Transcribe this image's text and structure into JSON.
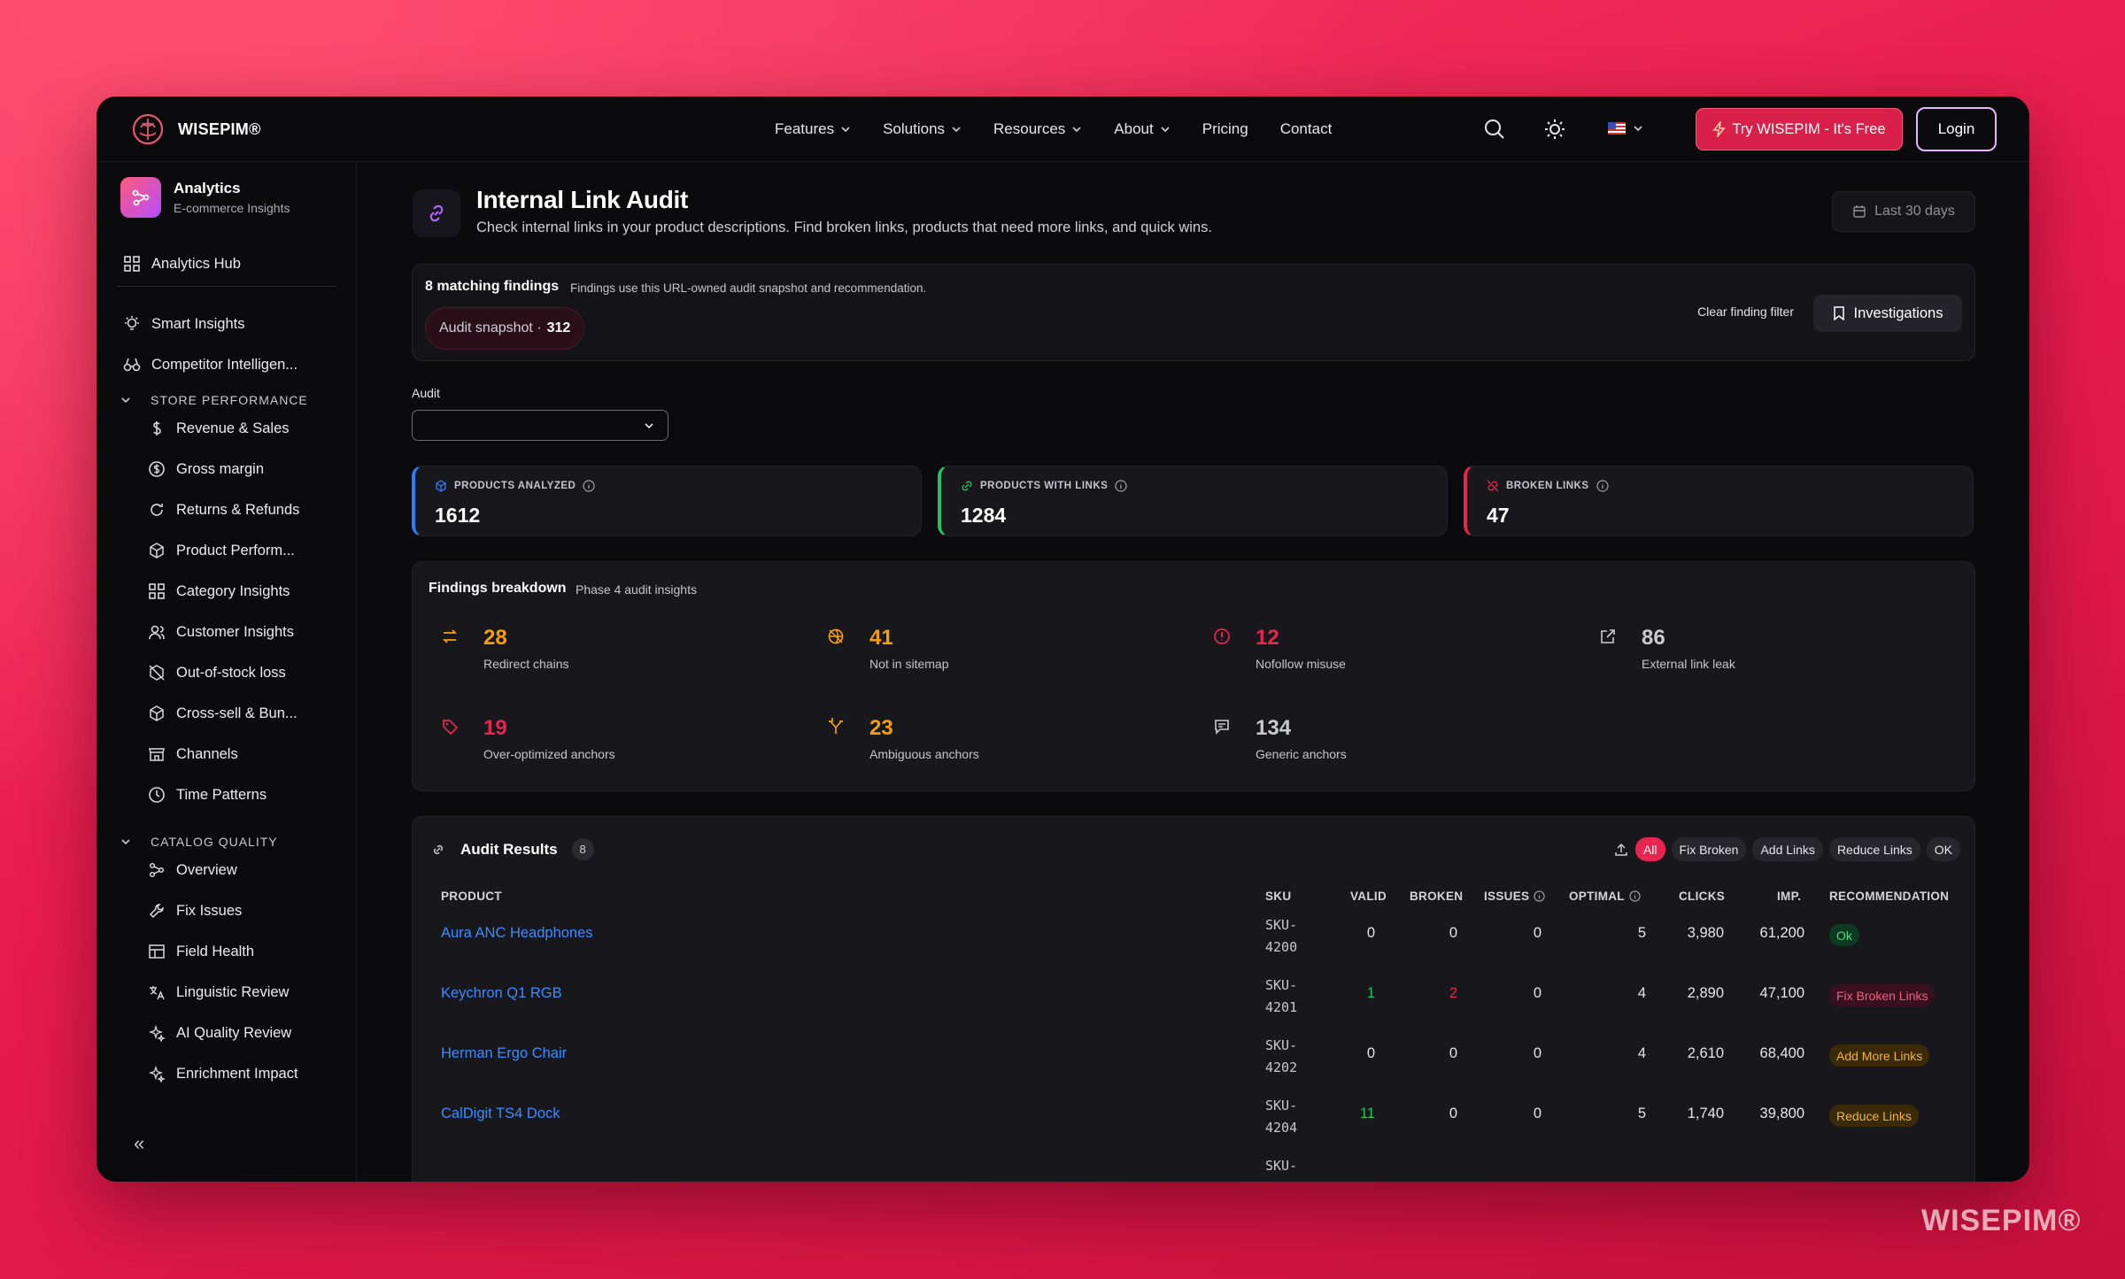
{
  "header": {
    "brand": "WISEPIM®",
    "nav": [
      {
        "label": "Features",
        "dropdown": true
      },
      {
        "label": "Solutions",
        "dropdown": true
      },
      {
        "label": "Resources",
        "dropdown": true
      },
      {
        "label": "About",
        "dropdown": true
      },
      {
        "label": "Pricing",
        "dropdown": false
      },
      {
        "label": "Contact",
        "dropdown": false
      }
    ],
    "try_label": "Try WISEPIM - It's Free",
    "login_label": "Login",
    "icons": [
      "search-icon",
      "sun-icon",
      "us-flag-icon"
    ]
  },
  "sidebar": {
    "title": "Analytics",
    "subtitle": "E-commerce Insights",
    "hub": "Analytics Hub",
    "top_items": [
      "Smart Insights",
      "Competitor Intelligen..."
    ],
    "store_section": "STORE PERFORMANCE",
    "store_items": [
      "Revenue & Sales",
      "Gross margin",
      "Returns & Refunds",
      "Product Perform...",
      "Category Insights",
      "Customer Insights",
      "Out-of-stock loss",
      "Cross-sell & Bun...",
      "Channels",
      "Time Patterns"
    ],
    "catalog_section": "CATALOG QUALITY",
    "catalog_items": [
      "Overview",
      "Fix Issues",
      "Field Health",
      "Linguistic Review",
      "AI Quality Review",
      "Enrichment Impact"
    ],
    "collapse": "«"
  },
  "page": {
    "title": "Internal Link Audit",
    "description": "Check internal links in your product descriptions. Find broken links, products that need more links, and quick wins.",
    "period": "Last 30 days"
  },
  "findings": {
    "title": "8 matching findings",
    "note": "Findings use this URL-owned audit snapshot and recommendation.",
    "snapshot_label": "Audit snapshot ·",
    "snapshot_value": "312",
    "clear_label": "Clear finding filter",
    "investigations_label": "Investigations"
  },
  "audit": {
    "label": "Audit",
    "value": ""
  },
  "kpis": [
    {
      "label": "PRODUCTS ANALYZED",
      "value": "1612",
      "color": "#2f7bff"
    },
    {
      "label": "PRODUCTS WITH LINKS",
      "value": "1284",
      "color": "#22c55e"
    },
    {
      "label": "BROKEN LINKS",
      "value": "47",
      "color": "#e8254f"
    }
  ],
  "breakdown": {
    "title": "Findings breakdown",
    "subtitle": "Phase 4 audit insights",
    "items": [
      {
        "value": "28",
        "label": "Redirect chains",
        "color": "#f59e0b",
        "icon": "redirect-icon"
      },
      {
        "value": "41",
        "label": "Not in sitemap",
        "color": "#f59e0b",
        "icon": "no-sitemap-icon"
      },
      {
        "value": "12",
        "label": "Nofollow misuse",
        "color": "#e8254f",
        "icon": "alert-icon"
      },
      {
        "value": "86",
        "label": "External link leak",
        "color": "#c9c9d0",
        "icon": "external-link-icon"
      },
      {
        "value": "19",
        "label": "Over-optimized anchors",
        "color": "#e8254f",
        "icon": "tag-icon"
      },
      {
        "value": "23",
        "label": "Ambiguous anchors",
        "color": "#f59e0b",
        "icon": "split-icon"
      },
      {
        "value": "134",
        "label": "Generic anchors",
        "color": "#c9c9d0",
        "icon": "comment-icon"
      }
    ]
  },
  "results": {
    "title": "Audit Results",
    "count": "8",
    "filters": [
      "All",
      "Fix Broken",
      "Add Links",
      "Reduce Links",
      "OK"
    ],
    "columns": [
      "PRODUCT",
      "SKU",
      "VALID",
      "BROKEN",
      "ISSUES",
      "OPTIMAL",
      "CLICKS",
      "IMP.",
      "RECOMMENDATION"
    ],
    "rows": [
      {
        "product": "Aura ANC Headphones",
        "sku1": "SKU-",
        "sku2": "4200",
        "valid": "0",
        "broken": "0",
        "issues": "0",
        "optimal": "5",
        "clicks": "3,980",
        "imp": "61,200",
        "rec": "Ok",
        "rec_type": "ok"
      },
      {
        "product": "Keychron Q1 RGB",
        "sku1": "SKU-",
        "sku2": "4201",
        "valid": "1",
        "broken": "2",
        "issues": "0",
        "optimal": "4",
        "clicks": "2,890",
        "imp": "47,100",
        "rec": "Fix Broken Links",
        "rec_type": "fix"
      },
      {
        "product": "Herman Ergo Chair",
        "sku1": "SKU-",
        "sku2": "4202",
        "valid": "0",
        "broken": "0",
        "issues": "0",
        "optimal": "4",
        "clicks": "2,610",
        "imp": "68,400",
        "rec": "Add More Links",
        "rec_type": "add"
      },
      {
        "product": "CalDigit TS4 Dock",
        "sku1": "SKU-",
        "sku2": "4204",
        "valid": "11",
        "broken": "0",
        "issues": "0",
        "optimal": "5",
        "clicks": "1,740",
        "imp": "39,800",
        "rec": "Reduce Links",
        "rec_type": "reduce"
      },
      {
        "product": "",
        "sku1": "SKU-",
        "sku2": "",
        "valid": "",
        "broken": "",
        "issues": "",
        "optimal": "",
        "clicks": "",
        "imp": "",
        "rec": "",
        "rec_type": ""
      }
    ]
  },
  "watermark": "WISEPIM®"
}
